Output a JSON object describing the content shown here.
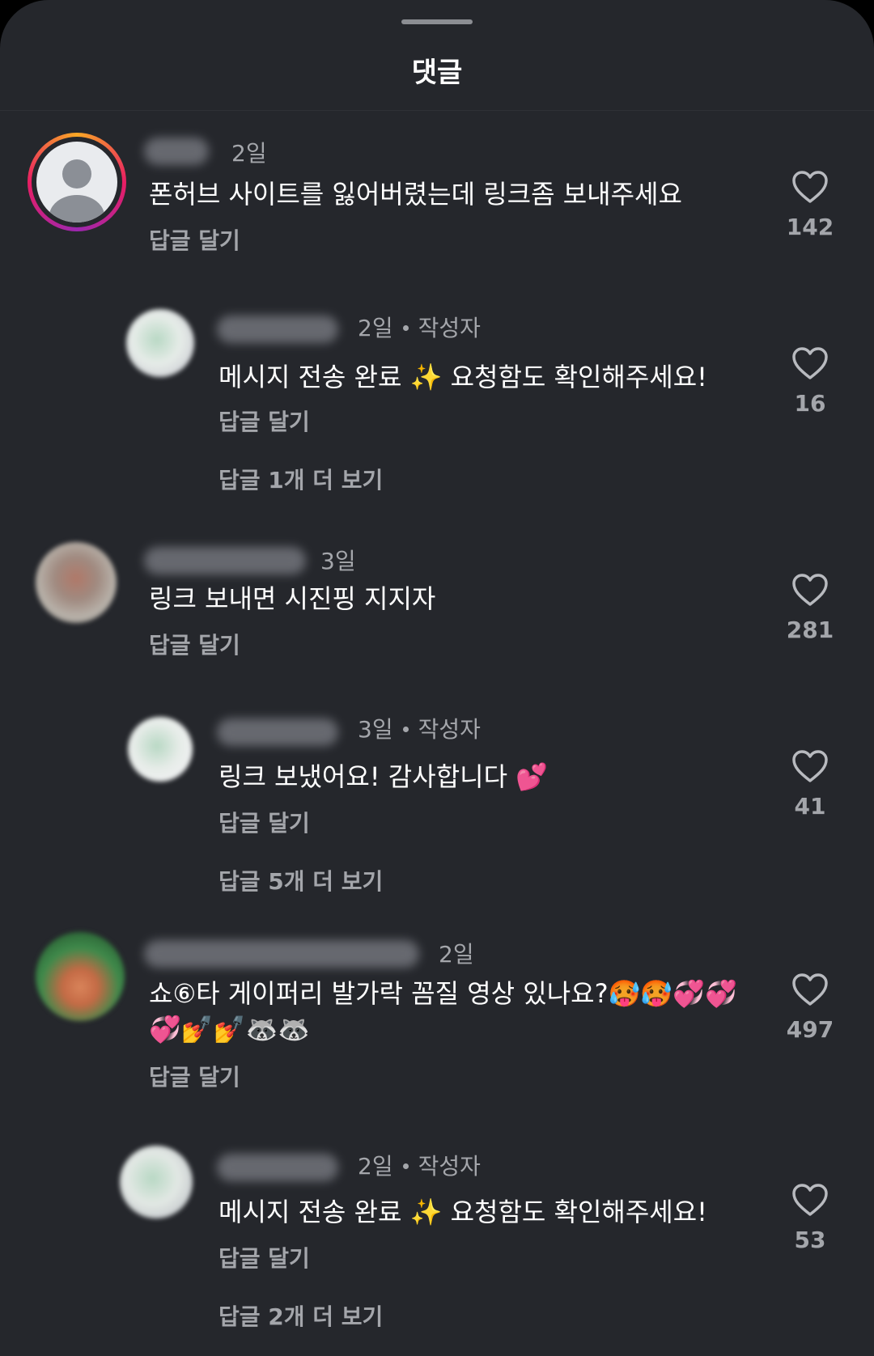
{
  "header": {
    "title": "댓글"
  },
  "comments": [
    {
      "time": "2일",
      "text": "폰허브 사이트를 잃어버렸는데 링크좀 보내주세요",
      "reply": "답글 달기",
      "likes": "142"
    },
    {
      "time": "2일",
      "author_tag": "작성자",
      "text": "메시지 전송 완료 ✨ 요청함도 확인해주세요!",
      "reply": "답글 달기",
      "likes": "16",
      "more": "답글 1개 더 보기"
    },
    {
      "time": "3일",
      "text": "링크 보내면 시진핑 지지자",
      "reply": "답글 달기",
      "likes": "281"
    },
    {
      "time": "3일",
      "author_tag": "작성자",
      "text": "링크 보냈어요! 감사합니다 💕",
      "reply": "답글 달기",
      "likes": "41",
      "more": "답글 5개 더 보기"
    },
    {
      "time": "2일",
      "text_line1": "쇼⑥타 게이퍼리 발가락 꼼질 영상 있나요?🥵🥵💞💞",
      "text_line2": "💞💅💅🦝🦝",
      "reply": "답글 달기",
      "likes": "497"
    },
    {
      "time": "2일",
      "author_tag": "작성자",
      "text": "메시지 전송 완료 ✨ 요청함도 확인해주세요!",
      "reply": "답글 달기",
      "likes": "53",
      "more": "답글 2개 더 보기"
    }
  ],
  "icons": {
    "like": "heart-outline-icon"
  },
  "colors": {
    "background": "#25272c",
    "secondary_text": "#a4a6ab",
    "story_ring_start": "#f9a825",
    "story_ring_end": "#c2185b"
  }
}
